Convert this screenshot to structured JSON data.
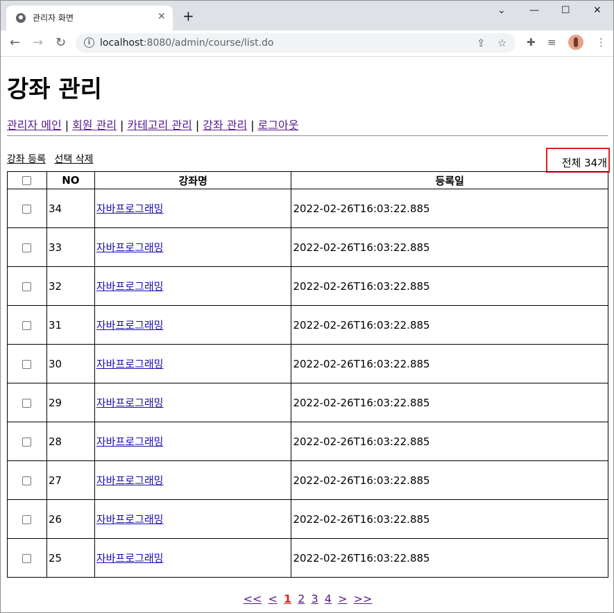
{
  "browser": {
    "tab_title": "관리자 화면",
    "url_host": "localhost",
    "url_path": ":8080/admin/course/list.do"
  },
  "page": {
    "title": "강좌 관리",
    "menu": [
      "관리자 메인",
      "회원 관리",
      "카테고리 관리",
      "강좌 관리",
      "로그아웃"
    ],
    "actions": {
      "add": "강좌 등록",
      "delete": "선택 삭제"
    },
    "total": "전체 34개"
  },
  "table": {
    "headers": [
      "",
      "NO",
      "강좌명",
      "등록일"
    ],
    "rows": [
      {
        "no": "34",
        "name": "자바프로그래밍",
        "date": "2022-02-26T16:03:22.885"
      },
      {
        "no": "33",
        "name": "자바프로그래밍",
        "date": "2022-02-26T16:03:22.885"
      },
      {
        "no": "32",
        "name": "자바프로그래밍",
        "date": "2022-02-26T16:03:22.885"
      },
      {
        "no": "31",
        "name": "자바프로그래밍",
        "date": "2022-02-26T16:03:22.885"
      },
      {
        "no": "30",
        "name": "자바프로그래밍",
        "date": "2022-02-26T16:03:22.885"
      },
      {
        "no": "29",
        "name": "자바프로그래밍",
        "date": "2022-02-26T16:03:22.885"
      },
      {
        "no": "28",
        "name": "자바프로그래밍",
        "date": "2022-02-26T16:03:22.885"
      },
      {
        "no": "27",
        "name": "자바프로그래밍",
        "date": "2022-02-26T16:03:22.885"
      },
      {
        "no": "26",
        "name": "자바프로그래밍",
        "date": "2022-02-26T16:03:22.885"
      },
      {
        "no": "25",
        "name": "자바프로그래밍",
        "date": "2022-02-26T16:03:22.885"
      }
    ]
  },
  "pager": {
    "first": "<<",
    "prev": "<",
    "pages": [
      "1",
      "2",
      "3",
      "4"
    ],
    "current": "1",
    "next": ">",
    "last": ">>"
  },
  "colors": {
    "highlight": "#e0201f",
    "visited_link": "#551a8b",
    "link": "#1a0dab"
  }
}
